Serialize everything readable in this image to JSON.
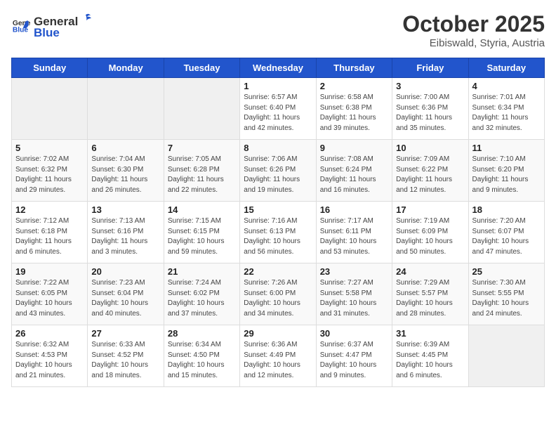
{
  "header": {
    "logo_general": "General",
    "logo_blue": "Blue",
    "month": "October 2025",
    "location": "Eibiswald, Styria, Austria"
  },
  "weekdays": [
    "Sunday",
    "Monday",
    "Tuesday",
    "Wednesday",
    "Thursday",
    "Friday",
    "Saturday"
  ],
  "weeks": [
    [
      {
        "day": "",
        "sunrise": "",
        "sunset": "",
        "daylight": ""
      },
      {
        "day": "",
        "sunrise": "",
        "sunset": "",
        "daylight": ""
      },
      {
        "day": "",
        "sunrise": "",
        "sunset": "",
        "daylight": ""
      },
      {
        "day": "1",
        "sunrise": "Sunrise: 6:57 AM",
        "sunset": "Sunset: 6:40 PM",
        "daylight": "Daylight: 11 hours and 42 minutes."
      },
      {
        "day": "2",
        "sunrise": "Sunrise: 6:58 AM",
        "sunset": "Sunset: 6:38 PM",
        "daylight": "Daylight: 11 hours and 39 minutes."
      },
      {
        "day": "3",
        "sunrise": "Sunrise: 7:00 AM",
        "sunset": "Sunset: 6:36 PM",
        "daylight": "Daylight: 11 hours and 35 minutes."
      },
      {
        "day": "4",
        "sunrise": "Sunrise: 7:01 AM",
        "sunset": "Sunset: 6:34 PM",
        "daylight": "Daylight: 11 hours and 32 minutes."
      }
    ],
    [
      {
        "day": "5",
        "sunrise": "Sunrise: 7:02 AM",
        "sunset": "Sunset: 6:32 PM",
        "daylight": "Daylight: 11 hours and 29 minutes."
      },
      {
        "day": "6",
        "sunrise": "Sunrise: 7:04 AM",
        "sunset": "Sunset: 6:30 PM",
        "daylight": "Daylight: 11 hours and 26 minutes."
      },
      {
        "day": "7",
        "sunrise": "Sunrise: 7:05 AM",
        "sunset": "Sunset: 6:28 PM",
        "daylight": "Daylight: 11 hours and 22 minutes."
      },
      {
        "day": "8",
        "sunrise": "Sunrise: 7:06 AM",
        "sunset": "Sunset: 6:26 PM",
        "daylight": "Daylight: 11 hours and 19 minutes."
      },
      {
        "day": "9",
        "sunrise": "Sunrise: 7:08 AM",
        "sunset": "Sunset: 6:24 PM",
        "daylight": "Daylight: 11 hours and 16 minutes."
      },
      {
        "day": "10",
        "sunrise": "Sunrise: 7:09 AM",
        "sunset": "Sunset: 6:22 PM",
        "daylight": "Daylight: 11 hours and 12 minutes."
      },
      {
        "day": "11",
        "sunrise": "Sunrise: 7:10 AM",
        "sunset": "Sunset: 6:20 PM",
        "daylight": "Daylight: 11 hours and 9 minutes."
      }
    ],
    [
      {
        "day": "12",
        "sunrise": "Sunrise: 7:12 AM",
        "sunset": "Sunset: 6:18 PM",
        "daylight": "Daylight: 11 hours and 6 minutes."
      },
      {
        "day": "13",
        "sunrise": "Sunrise: 7:13 AM",
        "sunset": "Sunset: 6:16 PM",
        "daylight": "Daylight: 11 hours and 3 minutes."
      },
      {
        "day": "14",
        "sunrise": "Sunrise: 7:15 AM",
        "sunset": "Sunset: 6:15 PM",
        "daylight": "Daylight: 10 hours and 59 minutes."
      },
      {
        "day": "15",
        "sunrise": "Sunrise: 7:16 AM",
        "sunset": "Sunset: 6:13 PM",
        "daylight": "Daylight: 10 hours and 56 minutes."
      },
      {
        "day": "16",
        "sunrise": "Sunrise: 7:17 AM",
        "sunset": "Sunset: 6:11 PM",
        "daylight": "Daylight: 10 hours and 53 minutes."
      },
      {
        "day": "17",
        "sunrise": "Sunrise: 7:19 AM",
        "sunset": "Sunset: 6:09 PM",
        "daylight": "Daylight: 10 hours and 50 minutes."
      },
      {
        "day": "18",
        "sunrise": "Sunrise: 7:20 AM",
        "sunset": "Sunset: 6:07 PM",
        "daylight": "Daylight: 10 hours and 47 minutes."
      }
    ],
    [
      {
        "day": "19",
        "sunrise": "Sunrise: 7:22 AM",
        "sunset": "Sunset: 6:05 PM",
        "daylight": "Daylight: 10 hours and 43 minutes."
      },
      {
        "day": "20",
        "sunrise": "Sunrise: 7:23 AM",
        "sunset": "Sunset: 6:04 PM",
        "daylight": "Daylight: 10 hours and 40 minutes."
      },
      {
        "day": "21",
        "sunrise": "Sunrise: 7:24 AM",
        "sunset": "Sunset: 6:02 PM",
        "daylight": "Daylight: 10 hours and 37 minutes."
      },
      {
        "day": "22",
        "sunrise": "Sunrise: 7:26 AM",
        "sunset": "Sunset: 6:00 PM",
        "daylight": "Daylight: 10 hours and 34 minutes."
      },
      {
        "day": "23",
        "sunrise": "Sunrise: 7:27 AM",
        "sunset": "Sunset: 5:58 PM",
        "daylight": "Daylight: 10 hours and 31 minutes."
      },
      {
        "day": "24",
        "sunrise": "Sunrise: 7:29 AM",
        "sunset": "Sunset: 5:57 PM",
        "daylight": "Daylight: 10 hours and 28 minutes."
      },
      {
        "day": "25",
        "sunrise": "Sunrise: 7:30 AM",
        "sunset": "Sunset: 5:55 PM",
        "daylight": "Daylight: 10 hours and 24 minutes."
      }
    ],
    [
      {
        "day": "26",
        "sunrise": "Sunrise: 6:32 AM",
        "sunset": "Sunset: 4:53 PM",
        "daylight": "Daylight: 10 hours and 21 minutes."
      },
      {
        "day": "27",
        "sunrise": "Sunrise: 6:33 AM",
        "sunset": "Sunset: 4:52 PM",
        "daylight": "Daylight: 10 hours and 18 minutes."
      },
      {
        "day": "28",
        "sunrise": "Sunrise: 6:34 AM",
        "sunset": "Sunset: 4:50 PM",
        "daylight": "Daylight: 10 hours and 15 minutes."
      },
      {
        "day": "29",
        "sunrise": "Sunrise: 6:36 AM",
        "sunset": "Sunset: 4:49 PM",
        "daylight": "Daylight: 10 hours and 12 minutes."
      },
      {
        "day": "30",
        "sunrise": "Sunrise: 6:37 AM",
        "sunset": "Sunset: 4:47 PM",
        "daylight": "Daylight: 10 hours and 9 minutes."
      },
      {
        "day": "31",
        "sunrise": "Sunrise: 6:39 AM",
        "sunset": "Sunset: 4:45 PM",
        "daylight": "Daylight: 10 hours and 6 minutes."
      },
      {
        "day": "",
        "sunrise": "",
        "sunset": "",
        "daylight": ""
      }
    ]
  ]
}
